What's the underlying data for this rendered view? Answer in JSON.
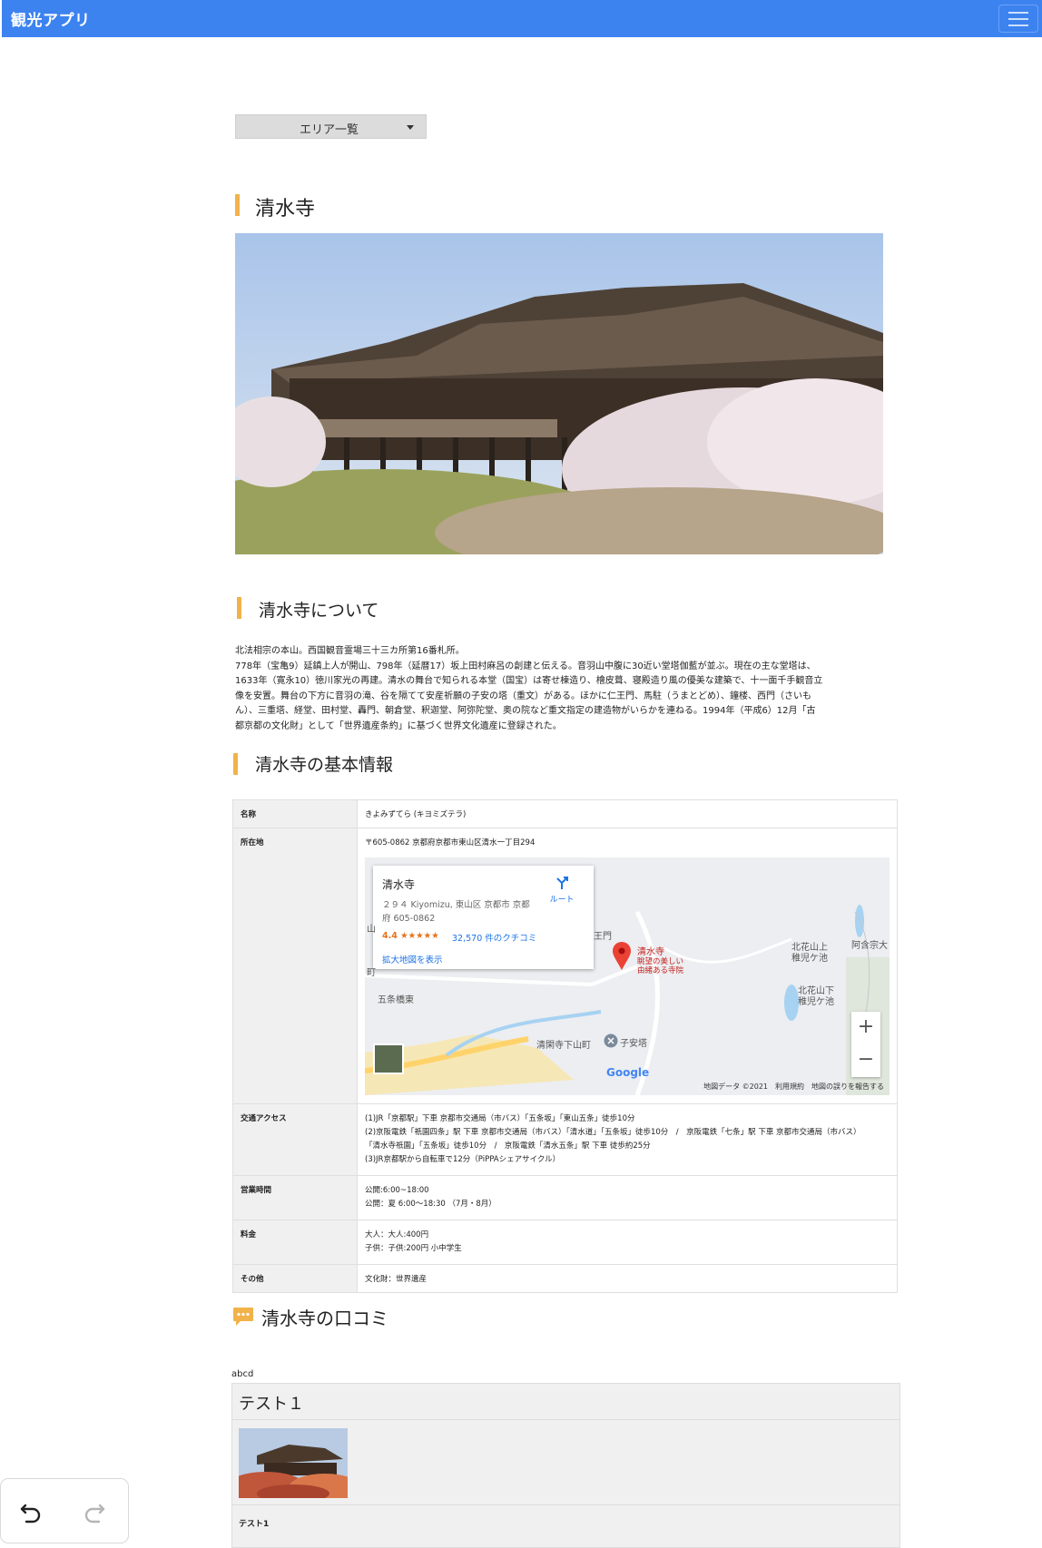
{
  "app": {
    "brand": "観光アプリ"
  },
  "nav": {
    "area_dropdown": "エリア一覧"
  },
  "spot": {
    "title": "清水寺",
    "about_heading": "清水寺について",
    "about_lines": [
      "北法相宗の本山。西国観音霊場三十三カ所第16番札所。",
      "778年（宝亀9）延鎮上人が開山、798年（延暦17）坂上田村麻呂の創建と伝える。音羽山中腹に30近い堂塔伽藍が並ぶ。現在の主な堂塔は、",
      "1633年（寛永10）徳川家光の再建。清水の舞台で知られる本堂（国宝）は寄せ棟造り、檜皮葺、寝殿造り風の優美な建築で、十一面千手観音立",
      "像を安置。舞台の下方に音羽の滝、谷を隔てて安産祈願の子安の塔（重文）がある。ほかに仁王門、馬駐（うまとどめ）、鐘楼、西門（さいも",
      "ん）、三重塔、経堂、田村堂、轟門、朝倉堂、釈迦堂、阿弥陀堂、奥の院など重文指定の建造物がいらかを連ねる。1994年（平成6）12月「古",
      "都京都の文化財」として「世界遺産条約」に基づく世界文化遺産に登録された。"
    ],
    "info_heading": "清水寺の基本情報",
    "info": {
      "name_label": "名称",
      "name_value": "きよみずてら (キヨミズテラ)",
      "address_label": "所在地",
      "address_value": "〒605-0862 京都府京都市東山区清水一丁目294",
      "access_label": "交通アクセス",
      "access_lines": [
        "(1)JR「京都駅」下車 京都市交通局（市バス）「五条坂」「東山五条」徒歩10分",
        "(2)京阪電鉄「祇園四条」駅 下車 京都市交通局（市バス）「清水道」「五条坂」徒歩10分　/　京阪電鉄「七条」駅 下車 京都市交通局（市バス）",
        "「清水寺祇園」「五条坂」徒歩10分　/　京阪電鉄「清水五条」駅 下車 徒歩約25分",
        "(3)JR京都駅から自転車で12分（PiPPAシェアサイクル）"
      ],
      "hours_label": "営業時間",
      "hours_lines": [
        "公開:6:00~18:00",
        "公開：夏 6:00～18:30 （7月・8月）"
      ],
      "fee_label": "料金",
      "fee_lines": [
        "大人：大人:400円",
        "子供：子供:200円 小中学生"
      ],
      "other_label": "その他",
      "other_value": "文化財：世界遺産"
    },
    "map": {
      "place_title": "清水寺",
      "place_address": "２９４ Kiyomizu, 東山区 京都市 京都府 605-0862",
      "rating": "4.4 ★★★★★",
      "reviews": "32,570 件のクチコミ",
      "enlarge_link": "拡大地図を表示",
      "route": "ルート",
      "marker_label": "清水寺",
      "marker_sub1": "眺望の美しい",
      "marker_sub2": "由緒ある寺院",
      "label_gate": "王門",
      "label_gojo": "五条橋東",
      "label_kitakazan": "北花山上",
      "label_chigo": "稚児ケ池",
      "label_kitakazan2": "北花山下",
      "label_chigo2": "稚児ケ池",
      "label_amida": "阿含宗大",
      "label_seikanji": "清閑寺下山町",
      "label_koyasu": "子安塔",
      "label_machi": "町",
      "label_ji": "山",
      "zoom_in": "+",
      "zoom_out": "−",
      "google": "Google",
      "attribution": "地図データ ©2021　利用規約　地図の誤りを報告する"
    },
    "reviews_heading": "清水寺の口コミ",
    "reviews": [
      {
        "author": "abcd",
        "title": "テスト１",
        "body": "テスト1"
      }
    ]
  },
  "colors": {
    "navbar": "#3c83f0",
    "accent": "#f2b24a",
    "link": "#1a73e8"
  },
  "icons": {
    "menu": "hamburger-icon",
    "review": "chat-bubble-icon",
    "undo": "undo-icon",
    "redo": "redo-icon"
  }
}
